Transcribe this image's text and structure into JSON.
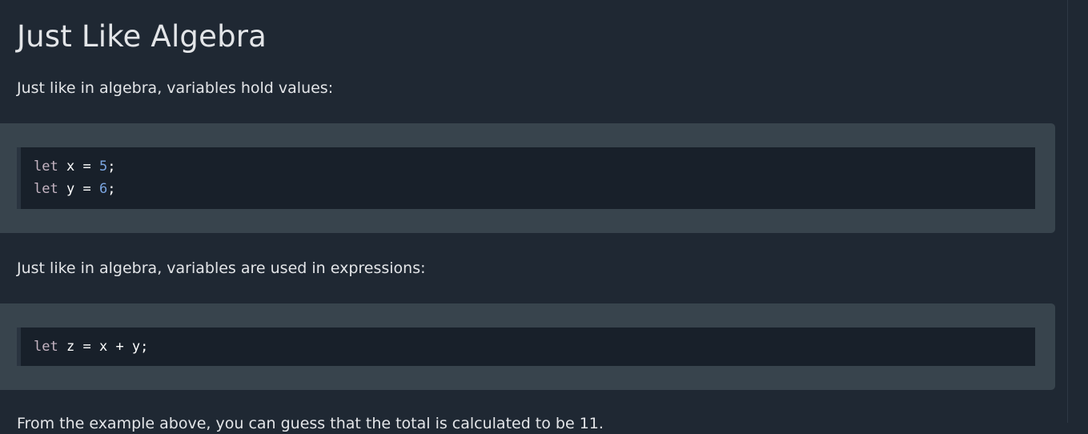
{
  "heading": "Just Like Algebra",
  "paragraphs": {
    "intro": "Just like in algebra, variables hold values:",
    "expressions": "Just like in algebra, variables are used in expressions:",
    "conclusion": "From the example above, you can guess that the total is calculated to be 11."
  },
  "examples": [
    {
      "lines": [
        {
          "kw": "let",
          "name": "x",
          "op": "=",
          "value": "5",
          "end": ";"
        },
        {
          "kw": "let",
          "name": "y",
          "op": "=",
          "value": "6",
          "end": ";"
        }
      ]
    },
    {
      "lines": [
        {
          "kw": "let",
          "name": "z",
          "op": "=",
          "expr": "x + y",
          "end": ";"
        }
      ]
    }
  ],
  "colors": {
    "page_background": "#1f2833",
    "example_background": "#38444d",
    "code_background": "#18202a",
    "keyword": "#c5b4c2",
    "number": "#7ba6e2",
    "text": "#e3e5e8"
  }
}
